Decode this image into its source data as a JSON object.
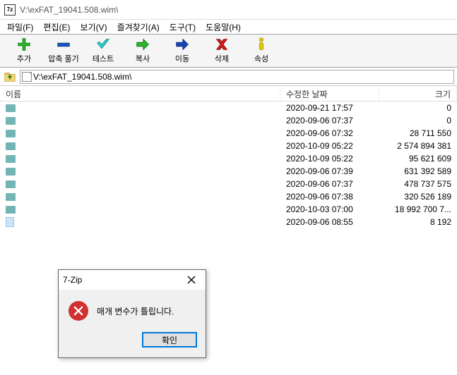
{
  "window": {
    "title": "V:\\exFAT_19041.508.wim\\",
    "app_icon_text": "7z"
  },
  "menu": {
    "file": "파일(F)",
    "edit": "편집(E)",
    "view": "보기(V)",
    "favorites": "즐겨찾기(A)",
    "tools": "도구(T)",
    "help": "도움말(H)"
  },
  "toolbar": {
    "add": "추가",
    "extract": "압축 풀기",
    "test": "테스트",
    "copy": "복사",
    "move": "이동",
    "delete": "삭제",
    "info": "속성"
  },
  "path": {
    "value": "V:\\exFAT_19041.508.wim\\"
  },
  "columns": {
    "name": "이름",
    "modified": "수정한 날짜",
    "size": "크기"
  },
  "rows": [
    {
      "type": "folder",
      "name": "",
      "date": "2020-09-21 17:57",
      "size": "0"
    },
    {
      "type": "folder",
      "name": "",
      "date": "2020-09-06 07:37",
      "size": "0"
    },
    {
      "type": "folder",
      "name": "",
      "date": "2020-09-06 07:32",
      "size": "28 711 550"
    },
    {
      "type": "folder",
      "name": "",
      "date": "2020-10-09 05:22",
      "size": "2 574 894 381"
    },
    {
      "type": "folder",
      "name": "",
      "date": "2020-10-09 05:22",
      "size": "95 621 609"
    },
    {
      "type": "folder",
      "name": "",
      "date": "2020-09-06 07:39",
      "size": "631 392 589"
    },
    {
      "type": "folder",
      "name": "",
      "date": "2020-09-06 07:37",
      "size": "478 737 575"
    },
    {
      "type": "folder",
      "name": "",
      "date": "2020-09-06 07:38",
      "size": "320 526 189"
    },
    {
      "type": "folder",
      "name": "",
      "date": "2020-10-03 07:00",
      "size": "18 992 700 7..."
    },
    {
      "type": "file",
      "name": "",
      "date": "2020-09-06 08:55",
      "size": "8 192"
    }
  ],
  "dialog": {
    "title": "7-Zip",
    "message": "매개 변수가 틀립니다.",
    "ok": "확인"
  }
}
